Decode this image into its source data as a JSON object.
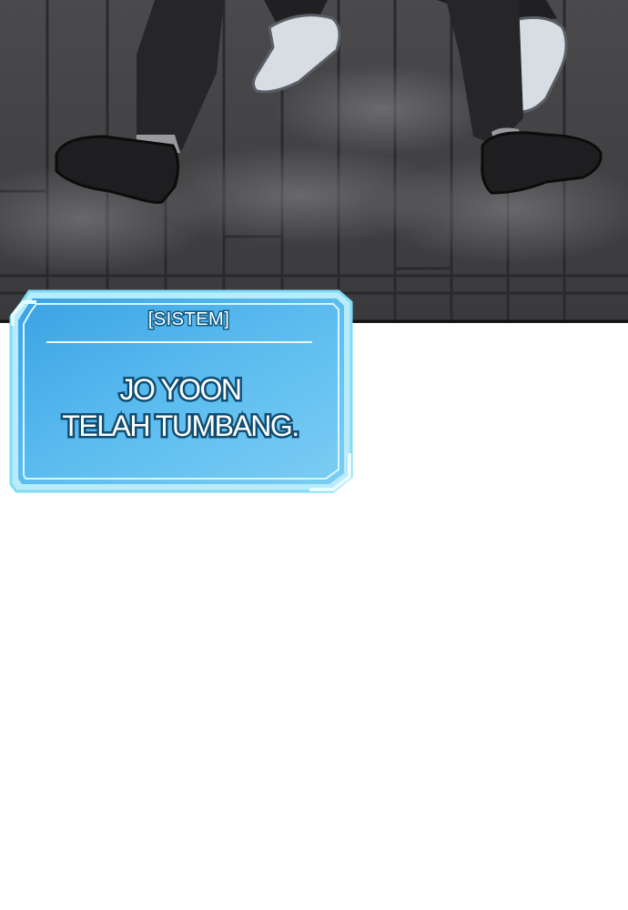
{
  "panel": {
    "scene_description_icon": "floor-feet-scene",
    "floor_color": "#3d3d3f"
  },
  "system_window": {
    "header": "[SISTEM]",
    "message_lines": [
      "JO YOON",
      "TELAH TUMBANG."
    ],
    "border_color": "#5fd6f4",
    "fill_color": "#48aee8",
    "text_outline_color": "#104d72"
  }
}
